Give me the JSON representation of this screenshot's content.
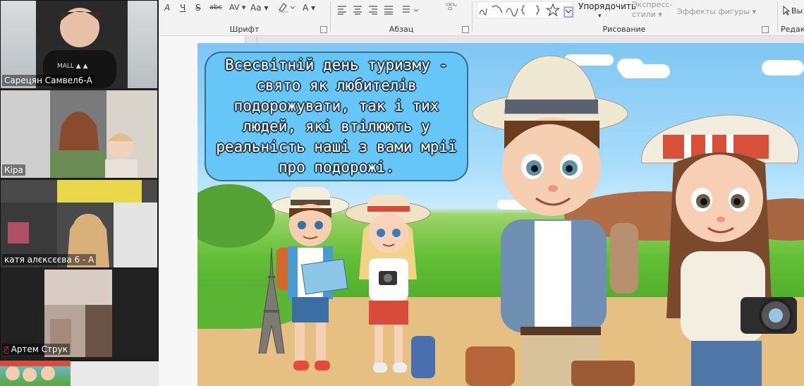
{
  "ribbon": {
    "font_group_label": "Шрифт",
    "paragraph_group_label": "Абзац",
    "drawing_group_label": "Рисование",
    "editing_group_label": "Редакт",
    "font_buttons": [
      "A",
      "Ч",
      "S",
      "abc",
      "AV ▾",
      "Aa ▾",
      "A ▾"
    ],
    "arrange_label": "Упорядочить",
    "quick_styles_label": "Экспресс-стили ▾",
    "shape_effects_label": "Эффекты фигуры ▾",
    "select_label": "Вы"
  },
  "slide": {
    "text": "Всесвітній день туризму - свято як любителів подорожувати, так і тих людей, які втілюють у реальність наші з вами мрії про подорожі."
  },
  "participants": [
    {
      "name": "Сарецян Самвел6-А",
      "muted": false
    },
    {
      "name": "Кіра",
      "muted": false
    },
    {
      "name": "катя алєксєєва 6 - А",
      "muted": false
    },
    {
      "name": "Артем Струк",
      "muted": true
    }
  ],
  "colors": {
    "ribbon_bg": "#f3f3f3",
    "textbox_fill": "#66c6f7",
    "textbox_border": "#3a6f8c",
    "muted_icon": "#e33333"
  }
}
